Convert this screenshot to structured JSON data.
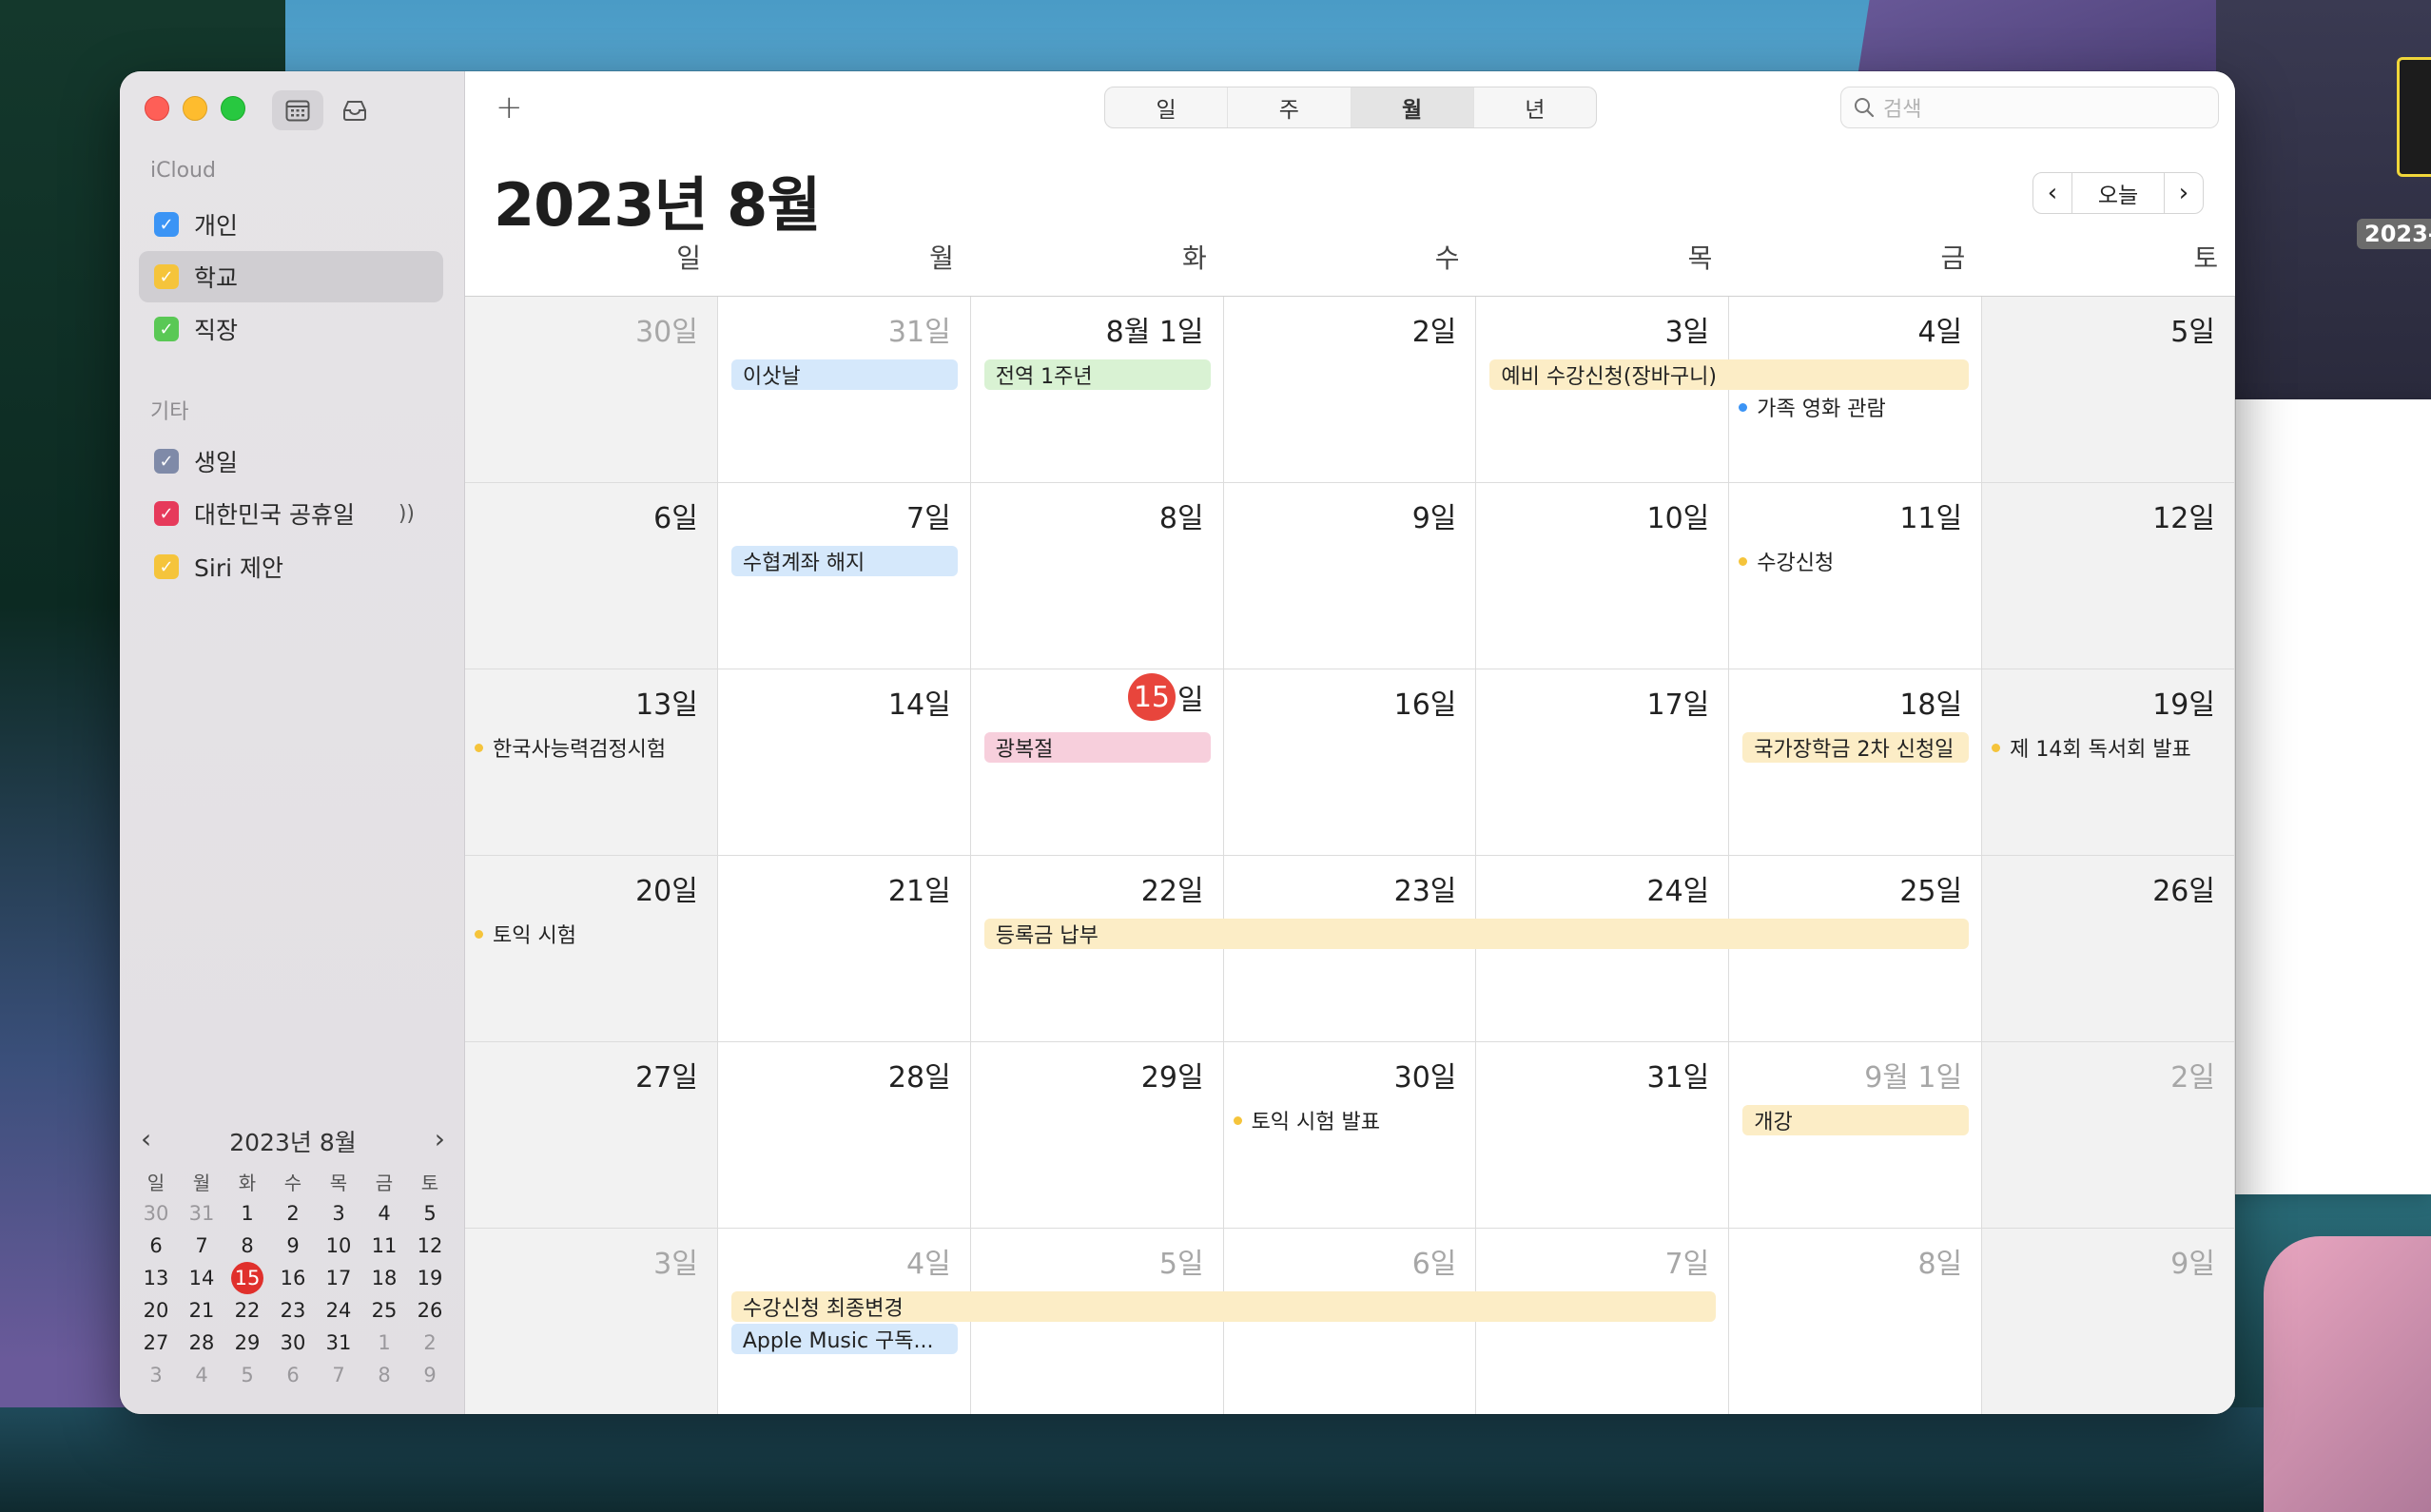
{
  "sidebar": {
    "section_icloud": "iCloud",
    "section_other": "기타",
    "calendars": [
      {
        "label": "개인",
        "color": "#3b94f5",
        "checked": true
      },
      {
        "label": "학교",
        "color": "#f5c43b",
        "checked": true,
        "selected": true
      },
      {
        "label": "직장",
        "color": "#5ac855",
        "checked": true
      }
    ],
    "other_calendars": [
      {
        "label": "생일",
        "color": "#7f8aa8",
        "checked": true
      },
      {
        "label": "대한민국 공휴일",
        "color": "#e63a5b",
        "checked": true,
        "extra": "))"
      },
      {
        "label": "Siri 제안",
        "color": "#f5c43b",
        "checked": true
      }
    ]
  },
  "mini_cal": {
    "title": "2023년 8월",
    "dow": [
      "일",
      "월",
      "화",
      "수",
      "목",
      "금",
      "토"
    ],
    "weeks": [
      [
        "30",
        "31",
        "1",
        "2",
        "3",
        "4",
        "5"
      ],
      [
        "6",
        "7",
        "8",
        "9",
        "10",
        "11",
        "12"
      ],
      [
        "13",
        "14",
        "15",
        "16",
        "17",
        "18",
        "19"
      ],
      [
        "20",
        "21",
        "22",
        "23",
        "24",
        "25",
        "26"
      ],
      [
        "27",
        "28",
        "29",
        "30",
        "31",
        "1",
        "2"
      ],
      [
        "3",
        "4",
        "5",
        "6",
        "7",
        "8",
        "9"
      ]
    ],
    "today": "15"
  },
  "toolbar": {
    "add": "+",
    "views": [
      "일",
      "주",
      "월",
      "년"
    ],
    "active_view": "월",
    "search_placeholder": "검색"
  },
  "header": {
    "title": "2023년 8월",
    "today_label": "오늘"
  },
  "weekdays": [
    "일",
    "월",
    "화",
    "수",
    "목",
    "금",
    "토"
  ],
  "weeks": [
    [
      "30일",
      "31일",
      "8월 1일",
      "2일",
      "3일",
      "4일",
      "5일"
    ],
    [
      "6일",
      "7일",
      "8일",
      "9일",
      "10일",
      "11일",
      "12일"
    ],
    [
      "13일",
      "14일",
      "15",
      "16일",
      "17일",
      "18일",
      "19일"
    ],
    [
      "20일",
      "21일",
      "22일",
      "23일",
      "24일",
      "25일",
      "26일"
    ],
    [
      "27일",
      "28일",
      "29일",
      "30일",
      "31일",
      "9월 1일",
      "2일"
    ],
    [
      "3일",
      "4일",
      "5일",
      "6일",
      "7일",
      "8일",
      "9일"
    ]
  ],
  "today_suffix": "일",
  "events": {
    "e1": "이삿날",
    "e2": "전역 1주년",
    "e3": "예비 수강신청(장바구니)",
    "e4": "가족 영화 관람",
    "e5": "수협계좌 해지",
    "e6": "수강신청",
    "e7": "한국사능력검정시험",
    "e8": "광복절",
    "e9": "국가장학금 2차 신청일",
    "e10": "제 14회 독서회 발표",
    "e11": "토익 시험",
    "e12": "등록금 납부",
    "e13": "토익 시험 발표",
    "e14": "개강",
    "e15": "수강신청 최종변경",
    "e16": "Apple Music 구독..."
  },
  "colors": {
    "today": "#e8453c",
    "blue_event": "#d5e8fb",
    "green_event": "#d9f2d3",
    "yellow_event": "#fcedc6",
    "pink_event": "#f7cfdc"
  },
  "background_window": {
    "label": "2023-"
  }
}
